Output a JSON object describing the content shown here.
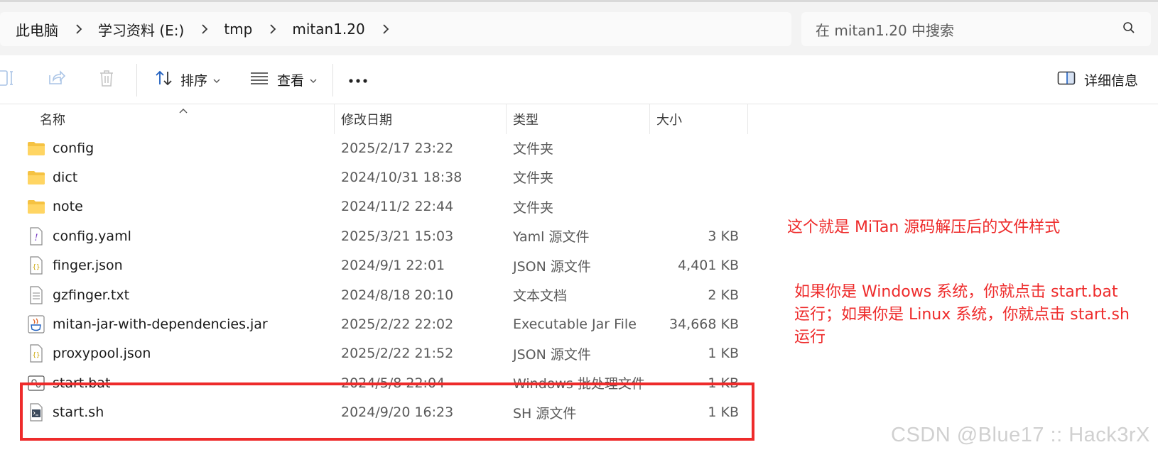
{
  "breadcrumb": {
    "items": [
      "此电脑",
      "学习资料 (E:)",
      "tmp",
      "mitan1.20"
    ]
  },
  "search": {
    "placeholder": "在 mitan1.20 中搜索"
  },
  "toolbar": {
    "sort_label": "排序",
    "view_label": "查看",
    "more_label": "...",
    "details_label": "详细信息"
  },
  "columns": {
    "name": "名称",
    "date": "修改日期",
    "type": "类型",
    "size": "大小"
  },
  "files": [
    {
      "name": "config",
      "date": "2025/2/17 23:22",
      "type": "文件夹",
      "size": "",
      "icon": "folder-icon"
    },
    {
      "name": "dict",
      "date": "2024/10/31 18:38",
      "type": "文件夹",
      "size": "",
      "icon": "folder-icon"
    },
    {
      "name": "note",
      "date": "2024/11/2 22:44",
      "type": "文件夹",
      "size": "",
      "icon": "folder-icon"
    },
    {
      "name": "config.yaml",
      "date": "2025/3/21 15:03",
      "type": "Yaml 源文件",
      "size": "3 KB",
      "icon": "yaml-file-icon"
    },
    {
      "name": "finger.json",
      "date": "2024/9/1 22:01",
      "type": "JSON 源文件",
      "size": "4,401 KB",
      "icon": "json-file-icon"
    },
    {
      "name": "gzfinger.txt",
      "date": "2024/8/18 20:10",
      "type": "文本文档",
      "size": "2 KB",
      "icon": "text-file-icon"
    },
    {
      "name": "mitan-jar-with-dependencies.jar",
      "date": "2025/2/22 22:02",
      "type": "Executable Jar File",
      "size": "34,668 KB",
      "icon": "jar-file-icon"
    },
    {
      "name": "proxypool.json",
      "date": "2025/2/22 21:52",
      "type": "JSON 源文件",
      "size": "1 KB",
      "icon": "json-file-icon"
    },
    {
      "name": "start.bat",
      "date": "2024/5/8 22:04",
      "type": "Windows 批处理文件",
      "size": "1 KB",
      "icon": "batch-file-icon"
    },
    {
      "name": "start.sh",
      "date": "2024/9/20 16:23",
      "type": "SH 源文件",
      "size": "1 KB",
      "icon": "shell-file-icon"
    }
  ],
  "annotations": {
    "note1": "这个就是 MiTan 源码解压后的文件样式",
    "note2": "如果你是 Windows 系统，你就点击 start.bat 运行；如果你是 Linux 系统，你就点击 start.sh 运行"
  },
  "watermark": "CSDN @Blue17 :: Hack3rX",
  "colors": {
    "annotation_red": "#ee2b2b",
    "folder_yellow": "#f5c242",
    "accent_blue": "#1f5fbf"
  }
}
